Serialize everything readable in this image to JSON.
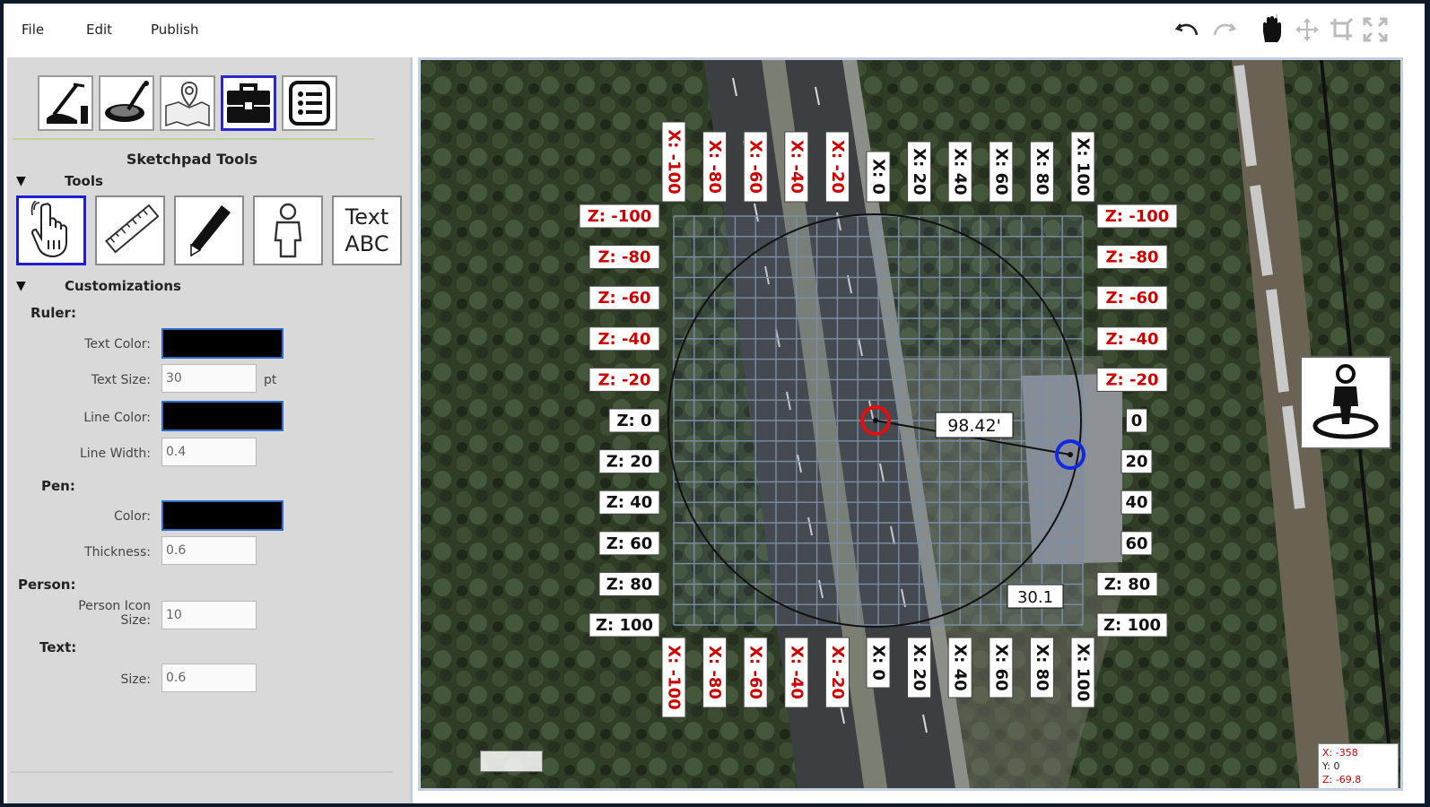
{
  "menu": {
    "file": "File",
    "edit": "Edit",
    "publish": "Publish"
  },
  "toolbar": {
    "icons": [
      "undo-icon",
      "redo-icon",
      "hand-pan-icon",
      "move-arrows-icon",
      "crop-icon",
      "fullscreen-icon"
    ]
  },
  "panel": {
    "top_tools": [
      "crime-scene-icon",
      "evidence-marker-icon",
      "map-pin-icon",
      "toolbox-icon",
      "list-icon"
    ],
    "active_top_tool": "toolbox-icon",
    "title": "Sketchpad Tools",
    "tools_section": "Tools",
    "tools": [
      {
        "name": "pointer-hand-icon",
        "active": true
      },
      {
        "name": "ruler-icon",
        "active": false
      },
      {
        "name": "pencil-icon",
        "active": false
      },
      {
        "name": "person-icon",
        "active": false
      },
      {
        "name": "text-tool",
        "label_line1": "Text",
        "label_line2": "ABC",
        "active": false
      }
    ],
    "customizations_section": "Customizations",
    "ruler": {
      "label": "Ruler:",
      "text_color_label": "Text Color:",
      "text_color": "#000000",
      "text_size_label": "Text Size:",
      "text_size": "30",
      "text_size_unit": "pt",
      "line_color_label": "Line Color:",
      "line_color": "#000000",
      "line_width_label": "Line Width:",
      "line_width": "0.4"
    },
    "pen": {
      "label": "Pen:",
      "color_label": "Color:",
      "color": "#000000",
      "thickness_label": "Thickness:",
      "thickness": "0.6"
    },
    "person": {
      "label": "Person:",
      "icon_size_label_1": "Person Icon",
      "icon_size_label_2": "Size:",
      "icon_size": "10"
    },
    "text": {
      "label": "Text:",
      "size_label": "Size:",
      "size": "0.6"
    }
  },
  "map": {
    "x_labels": [
      "X: -100",
      "X: -80",
      "X: -60",
      "X: -40",
      "X: -20",
      "X: 0",
      "X: 20",
      "X: 40",
      "X: 60",
      "X: 80",
      "X: 100"
    ],
    "z_labels": [
      "Z: -100",
      "Z: -80",
      "Z: -60",
      "Z: -40",
      "Z: -20",
      "Z: 0",
      "Z: 20",
      "Z: 40",
      "Z: 60",
      "Z: 80",
      "Z: 100"
    ],
    "z_labels_right": [
      "Z: -100",
      "Z: -80",
      "Z: -60",
      "Z: -40",
      "Z: -20",
      "0",
      "20",
      "40",
      "60",
      "Z: 80",
      "Z: 100"
    ],
    "negative_color": "#d00000",
    "positive_color": "#111111",
    "measurement": "98.42'",
    "measurement_2": "30.1",
    "scale_chip": "",
    "readout": {
      "x": "X: -358",
      "y": "Y: 0",
      "z": "Z: -69.8"
    },
    "start_marker_color": "#e01010",
    "end_marker_color": "#1028e0"
  }
}
